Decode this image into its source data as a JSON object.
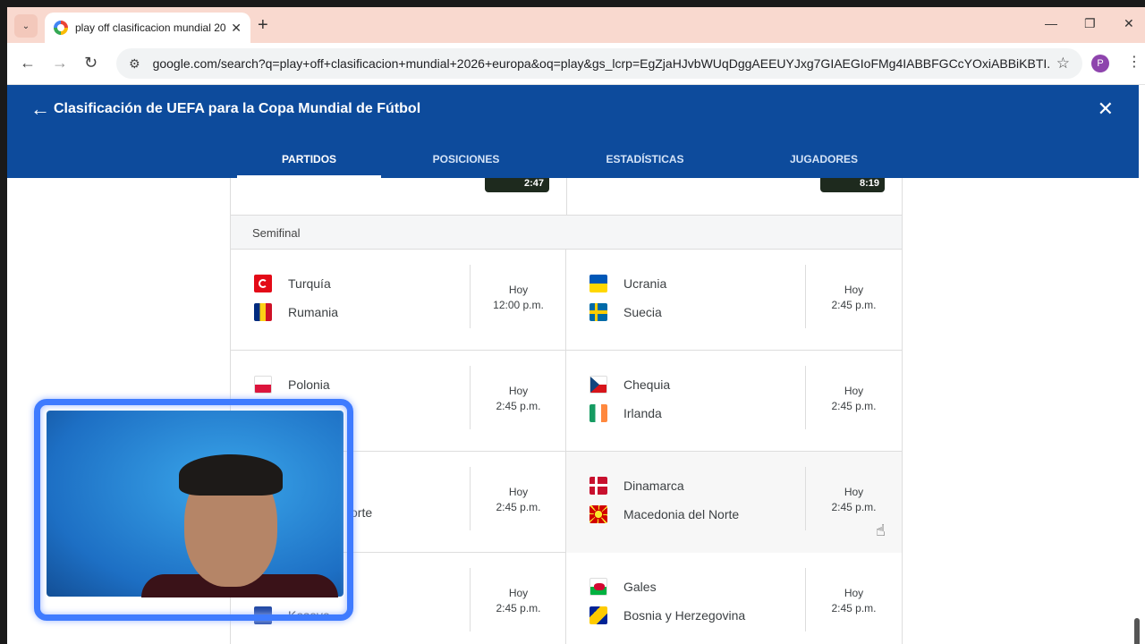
{
  "browser": {
    "tab_title": "play off clasificacion mundial 20",
    "url": "google.com/search?q=play+off+clasificacion+mundial+2026+europa&oq=play&gs_lcrp=EgZjaHJvbWUqDggAEEUYJxg7GIAEGIoFMg4IABBFGCcYOxiABBiKBTI...",
    "profile_initial": "P"
  },
  "header": {
    "title": "Clasificación de UEFA para la Copa Mundial de Fútbol",
    "tabs": [
      "PARTIDOS",
      "POSICIONES",
      "ESTADÍSTICAS",
      "JUGADORES"
    ],
    "active_tab": "PARTIDOS"
  },
  "top_thumbs": [
    "2:47",
    "8:19"
  ],
  "stage_label": "Semifinal",
  "rows": [
    [
      {
        "team1": "Turquía",
        "team2": "Rumania",
        "flag1": "turkey-flag-icon",
        "flag2": "romania-flag-icon",
        "day": "Hoy",
        "time": "12:00 p.m."
      },
      {
        "team1": "Ucrania",
        "team2": "Suecia",
        "flag1": "ukraine-flag-icon",
        "flag2": "sweden-flag-icon",
        "day": "Hoy",
        "time": "2:45 p.m."
      }
    ],
    [
      {
        "team1": "Polonia",
        "team2": "",
        "flag1": "poland-flag-icon",
        "flag2": "",
        "day": "Hoy",
        "time": "2:45 p.m."
      },
      {
        "team1": "Chequia",
        "team2": "Irlanda",
        "flag1": "czechia-flag-icon",
        "flag2": "ireland-flag-icon",
        "day": "Hoy",
        "time": "2:45 p.m."
      }
    ],
    [
      {
        "team1": "",
        "team2": "orte",
        "flag1": "",
        "flag2": "",
        "day": "Hoy",
        "time": "2:45 p.m."
      },
      {
        "team1": "Dinamarca",
        "team2": "Macedonia del Norte",
        "flag1": "denmark-flag-icon",
        "flag2": "north-macedonia-flag-icon",
        "day": "Hoy",
        "time": "2:45 p.m."
      }
    ],
    [
      {
        "team1": "",
        "team2": "Kosovo",
        "flag1": "",
        "flag2": "kosovo-flag-icon",
        "day": "Hoy",
        "time": "2:45 p.m."
      },
      {
        "team1": "Gales",
        "team2": "Bosnia y Herzegovina",
        "flag1": "wales-flag-icon",
        "flag2": "bosnia-flag-icon",
        "day": "Hoy",
        "time": "2:45 p.m."
      }
    ]
  ],
  "colors": {
    "header_blue": "#0d4b9c",
    "tab_strip": "#f9d9cf",
    "cam_ring": "#3f7bff"
  }
}
